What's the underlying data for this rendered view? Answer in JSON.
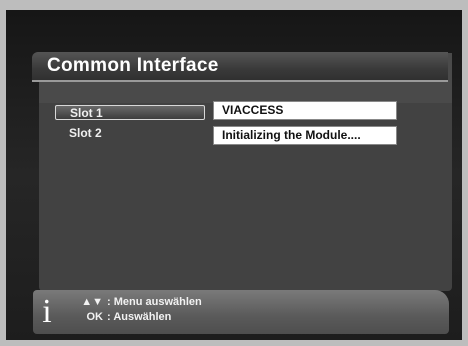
{
  "title": "Common Interface",
  "slots": [
    {
      "label": "Slot 1",
      "selected": true
    },
    {
      "label": "Slot 2",
      "selected": false
    }
  ],
  "values": [
    "VIACCESS",
    "Initializing the Module...."
  ],
  "info": {
    "icon": "info-icon",
    "icon_glyph": "i",
    "hints": [
      {
        "key": "▲▼",
        "sep": ":",
        "text": "Menu auswählen"
      },
      {
        "key": "OK",
        "sep": ":",
        "text": "Auswählen"
      }
    ]
  },
  "colors": {
    "panel": "#424242",
    "value_box": "#ffffff",
    "info_bar": "#6a6a6a"
  }
}
